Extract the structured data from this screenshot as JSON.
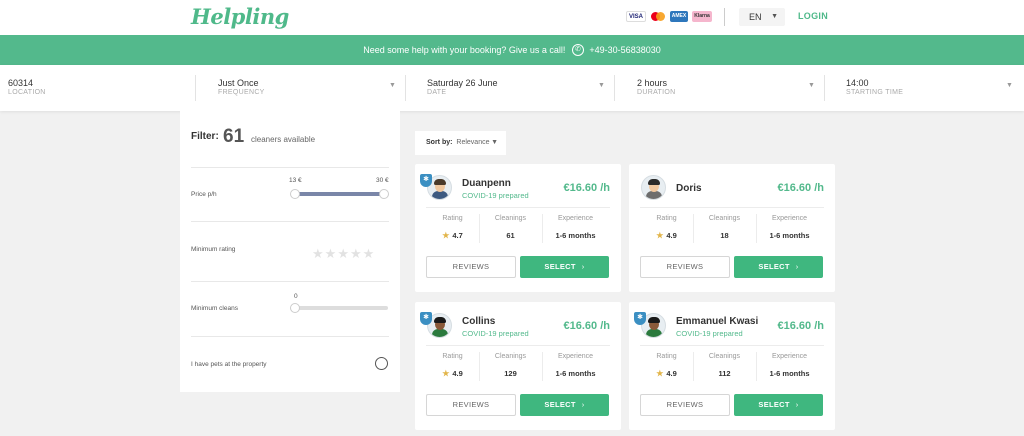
{
  "header": {
    "logo": "Helpling",
    "payments": [
      "VISA",
      "Mastercard",
      "AMEX",
      "Klarna"
    ],
    "language": "EN",
    "login": "LOGIN"
  },
  "banner": {
    "text": "Need some help with your booking? Give us a call!",
    "phone": "+49-30-56838030"
  },
  "booking": {
    "fields": [
      {
        "value": "60314",
        "label": "LOCATION"
      },
      {
        "value": "Just Once",
        "label": "FREQUENCY"
      },
      {
        "value": "Saturday 26 June",
        "label": "DATE"
      },
      {
        "value": "2 hours",
        "label": "DURATION"
      },
      {
        "value": "14:00",
        "label": "STARTING TIME"
      }
    ]
  },
  "filter": {
    "title": "Filter:",
    "count": "61",
    "available": "cleaners available",
    "price_label": "Price p/h",
    "price_min": "13 €",
    "price_max": "30 €",
    "rating_label": "Minimum rating",
    "cleans_label": "Minimum cleans",
    "cleans_min": "0",
    "pets_label": "I have pets at the property"
  },
  "sort": {
    "label": "Sort by:",
    "value": "Relevance"
  },
  "stat_labels": {
    "rating": "Rating",
    "cleanings": "Cleanings",
    "experience": "Experience"
  },
  "buttons": {
    "reviews": "REVIEWS",
    "select": "SELECT"
  },
  "cleaners": [
    {
      "name": "Duanpenn",
      "covid": "COVID-19 prepared",
      "price": "€16.60 /h",
      "rating": "4.7",
      "cleanings": "61",
      "experience": "1-6 months"
    },
    {
      "name": "Doris",
      "covid": "",
      "price": "€16.60 /h",
      "rating": "4.9",
      "cleanings": "18",
      "experience": "1-6 months"
    },
    {
      "name": "Collins",
      "covid": "COVID-19 prepared",
      "price": "€16.60 /h",
      "rating": "4.9",
      "cleanings": "129",
      "experience": "1-6 months"
    },
    {
      "name": "Emmanuel Kwasi",
      "covid": "COVID-19 prepared",
      "price": "€16.60 /h",
      "rating": "4.9",
      "cleanings": "112",
      "experience": "1-6 months"
    }
  ]
}
